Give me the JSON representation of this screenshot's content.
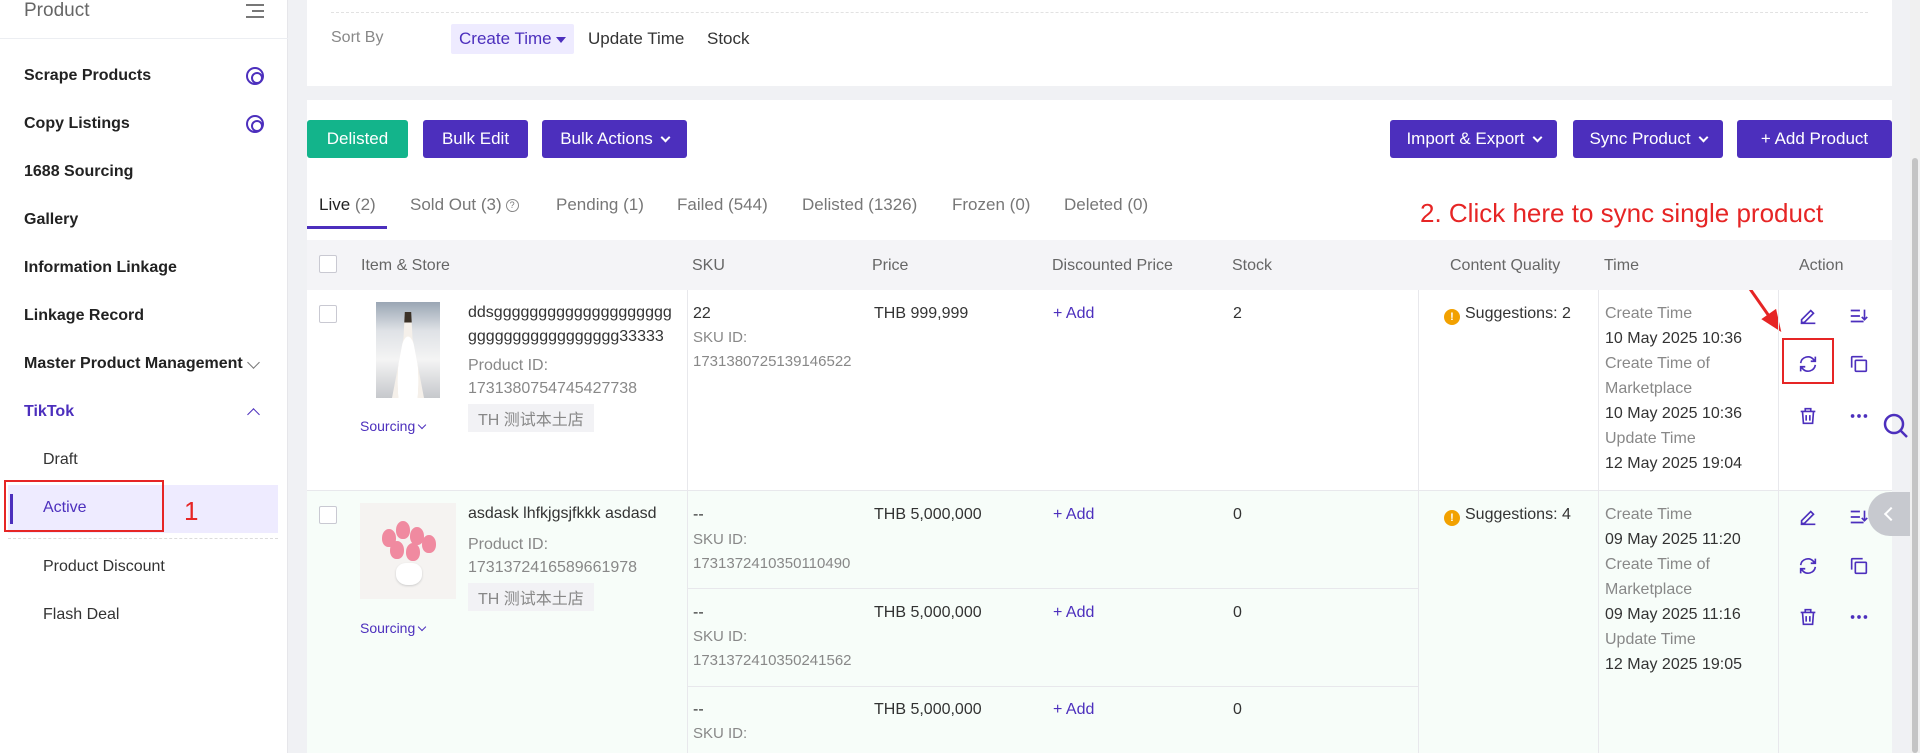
{
  "sidebar": {
    "title": "Product",
    "items": [
      {
        "label": "Scrape Products",
        "icon": "gear-icon"
      },
      {
        "label": "Copy Listings",
        "icon": "gear-icon"
      },
      {
        "label": "1688 Sourcing"
      },
      {
        "label": "Gallery"
      },
      {
        "label": "Information Linkage"
      },
      {
        "label": "Linkage Record"
      },
      {
        "label": "Master Product Management",
        "icon": "chevron-down-icon"
      },
      {
        "label": "TikTok",
        "icon": "chevron-up-icon"
      }
    ],
    "tiktok_sub": [
      "Draft",
      "Active",
      "Product Discount",
      "Flash Deal"
    ],
    "active_item": "Active"
  },
  "annotations": {
    "step1": "1",
    "step2": "2. Click here to sync single product",
    "highlight_color": "#e62525"
  },
  "sort": {
    "label": "Sort By",
    "options": [
      "Create Time",
      "Update Time",
      "Stock"
    ],
    "selected": "Create Time"
  },
  "toolbar": {
    "delisted": "Delisted",
    "bulk_edit": "Bulk Edit",
    "bulk_actions": "Bulk Actions",
    "import_export": "Import & Export",
    "sync_product": "Sync Product",
    "add_product": "+ Add Product"
  },
  "tabs": [
    {
      "label": "Live",
      "count": "(2)"
    },
    {
      "label": "Sold Out",
      "count": "(3)"
    },
    {
      "label": "Pending",
      "count": "(1)"
    },
    {
      "label": "Failed",
      "count": "(544)"
    },
    {
      "label": "Delisted",
      "count": "(1326)"
    },
    {
      "label": "Frozen",
      "count": "(0)"
    },
    {
      "label": "Deleted",
      "count": "(0)"
    }
  ],
  "table": {
    "headers": [
      "Item & Store",
      "SKU",
      "Price",
      "Discounted Price",
      "Stock",
      "Content Quality",
      "Time",
      "Action"
    ],
    "rows": [
      {
        "title_line1": "ddsgggggggggggggggggggg",
        "title_line2": "ggggggggggggggggg33333",
        "product_id_label": "Product ID:",
        "product_id": "1731380754745427738",
        "store": "TH 测试本土店",
        "sourcing": "Sourcing",
        "skus": [
          {
            "sku": "22",
            "sku_id_label": "SKU ID:",
            "sku_id": "1731380725139146522",
            "price": "THB 999,999",
            "discount": "+ Add",
            "stock": "2"
          }
        ],
        "quality": "Suggestions: 2",
        "create_time_label": "Create Time",
        "create_time": "10 May 2025 10:36",
        "market_label_1": "Create Time of",
        "market_label_2": "Marketplace",
        "market_time": "10 May 2025 10:36",
        "update_label": "Update Time",
        "update_time": "12 May 2025 19:04"
      },
      {
        "title_line1": "asdask lhfkjgsjfkkk asdasd",
        "product_id_label": "Product ID:",
        "product_id": "1731372416589661978",
        "store": "TH 测试本土店",
        "sourcing": "Sourcing",
        "skus": [
          {
            "sku": "--",
            "sku_id_label": "SKU ID:",
            "sku_id": "1731372410350110490",
            "price": "THB 5,000,000",
            "discount": "+ Add",
            "stock": "0"
          },
          {
            "sku": "--",
            "sku_id_label": "SKU ID:",
            "sku_id": "1731372410350241562",
            "price": "THB 5,000,000",
            "discount": "+ Add",
            "stock": "0"
          },
          {
            "sku": "--",
            "sku_id_label": "SKU ID:",
            "price": "THB 5,000,000",
            "discount": "+ Add",
            "stock": "0"
          }
        ],
        "quality": "Suggestions: 4",
        "create_time_label": "Create Time",
        "create_time": "09 May 2025 11:20",
        "market_label_1": "Create Time of",
        "market_label_2": "Marketplace",
        "market_time": "09 May 2025 11:16",
        "update_label": "Update Time",
        "update_time": "12 May 2025 19:05"
      }
    ]
  },
  "action_icons": [
    "edit-icon",
    "sort-icon",
    "sync-icon",
    "copy-icon",
    "delete-icon",
    "more-icon"
  ],
  "colors": {
    "primary": "#4c2fbd",
    "success": "#13b48b",
    "warning": "#f2a100"
  }
}
